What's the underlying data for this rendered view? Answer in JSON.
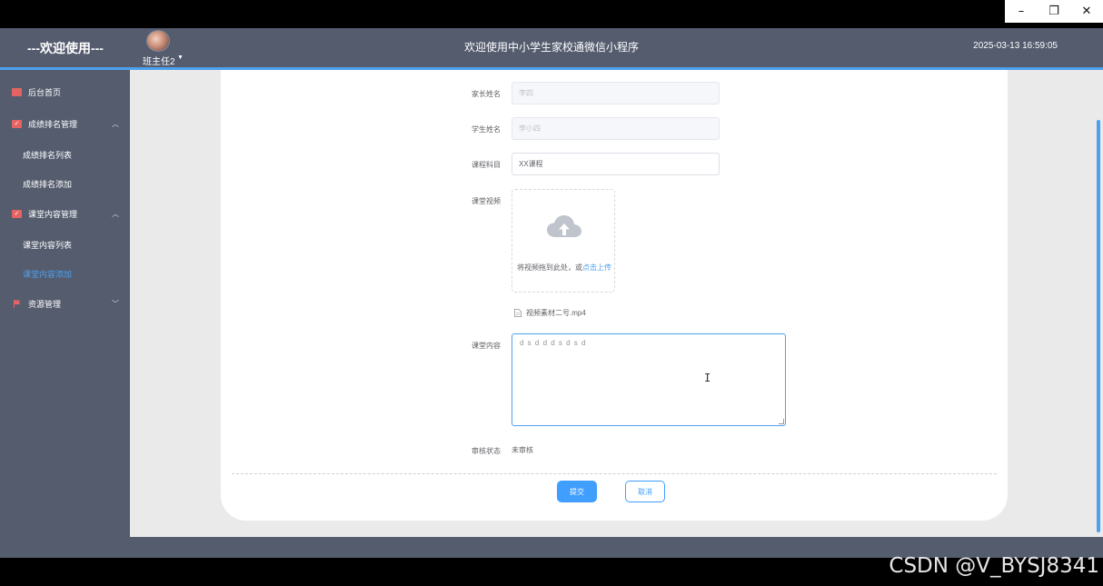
{
  "window": {
    "minimize": "–",
    "restore": "❐",
    "close": "✕"
  },
  "header": {
    "welcome": "---欢迎使用---",
    "user_name": "班主任2",
    "title": "欢迎使用中小学生家校通微信小程序",
    "datetime": "2025-03-13 16:59:05"
  },
  "sidebar": {
    "home": "后台首页",
    "score_mgmt": "成绩排名管理",
    "score_list": "成绩排名列表",
    "score_add": "成绩排名添加",
    "class_mgmt": "课堂内容管理",
    "class_list": "课堂内容列表",
    "class_add": "课堂内容添加",
    "resource_mgmt": "资源管理"
  },
  "form": {
    "parent_label": "家长姓名",
    "parent_value": "李四",
    "student_label": "学生姓名",
    "student_value": "李小四",
    "course_label": "课程科目",
    "course_value": "XX课程",
    "video_label": "课堂视频",
    "upload_hint": "将视频拖到此处，或",
    "upload_link": "点击上传",
    "file_name": "视频素材二号.mp4",
    "content_label": "课堂内容",
    "content_value": "d s d d d s d s d",
    "status_label": "审核状态",
    "status_value": "未审核"
  },
  "buttons": {
    "submit": "提交",
    "cancel": "取消"
  },
  "watermark": "CSDN @V_BYSJ8341",
  "colors": {
    "accent": "#409eff",
    "sidebar": "#545c6e",
    "icon_red": "#e46464"
  }
}
